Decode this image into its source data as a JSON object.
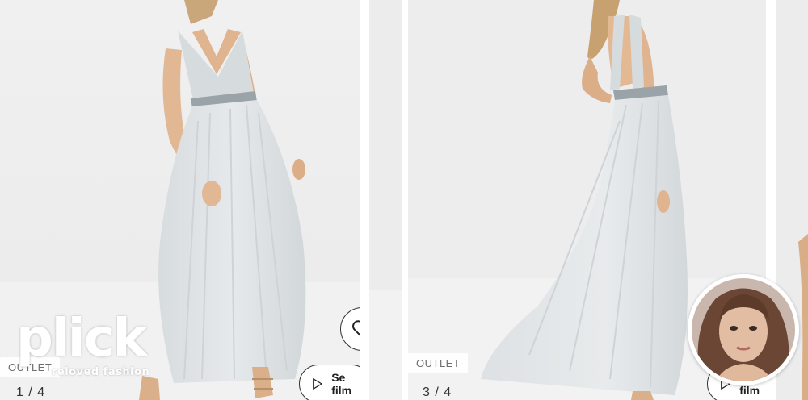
{
  "gallery": {
    "slides": [
      {
        "badge": "OUTLET",
        "counter": "1 / 4"
      },
      {
        "badge": "OUTLET",
        "counter": "3 / 4"
      }
    ],
    "film_button_label": "Se film"
  },
  "icons": {
    "heart": "heart-icon",
    "play": "play-icon"
  },
  "logo": {
    "wordmark": "plick",
    "tagline": "reloved fashion"
  },
  "colors": {
    "dress": "#dfe3e6",
    "backdrop": "#eeeeee",
    "floor": "#f3f3f3"
  }
}
